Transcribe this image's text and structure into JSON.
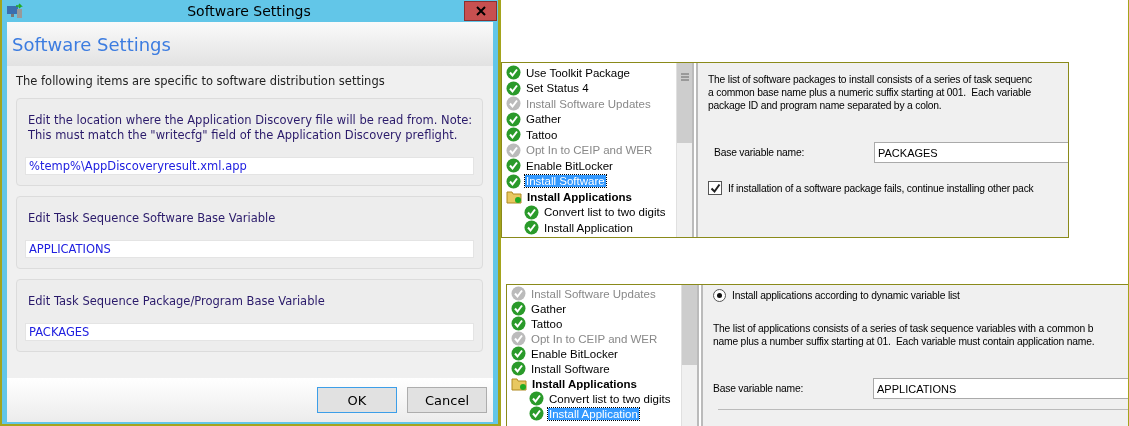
{
  "dialog": {
    "title": "Software Settings",
    "heading": "Software Settings",
    "intro": "The following items are specific to software distribution settings",
    "groups": [
      {
        "label": "Edit the location where the Application Discovery file will be read from. Note: This must match the \"writecfg\" field of the Application Discovery preflight.",
        "value": "%temp%\\AppDiscoveryresult.xml.app"
      },
      {
        "label": "Edit Task Sequence Software Base Variable",
        "value": "APPLICATIONS"
      },
      {
        "label": "Edit Task Sequence Package/Program Base Variable",
        "value": "PACKAGES"
      }
    ],
    "buttons": [
      {
        "label": "OK",
        "default": true
      },
      {
        "label": "Cancel",
        "default": false
      }
    ]
  },
  "panels": [
    {
      "tree": [
        {
          "label": "Use Toolkit Package",
          "kind": "step",
          "enabled": true,
          "selected": false
        },
        {
          "label": "Set Status 4",
          "kind": "step",
          "enabled": true,
          "selected": false
        },
        {
          "label": "Install Software Updates",
          "kind": "step",
          "enabled": false,
          "selected": false
        },
        {
          "label": "Gather",
          "kind": "step",
          "enabled": true,
          "selected": false
        },
        {
          "label": "Tattoo",
          "kind": "step",
          "enabled": true,
          "selected": false
        },
        {
          "label": "Opt In to CEIP and WER",
          "kind": "step",
          "enabled": false,
          "selected": false
        },
        {
          "label": "Enable BitLocker",
          "kind": "step",
          "enabled": true,
          "selected": false
        },
        {
          "label": "Install Software",
          "kind": "step",
          "enabled": true,
          "selected": true
        },
        {
          "label": "Install Applications",
          "kind": "group",
          "enabled": true,
          "selected": false,
          "children": [
            {
              "label": "Convert list to two digits",
              "kind": "step",
              "enabled": true,
              "selected": false
            },
            {
              "label": "Install Application",
              "kind": "step",
              "enabled": true,
              "selected": false
            }
          ]
        }
      ],
      "content": [
        {
          "kind": "text",
          "lines": [
            "The list of software packages to install consists of a series of task sequenc",
            "a common base name plus a numeric suffix starting at 001.  Each variable",
            "package ID and program name separated by a colon."
          ]
        },
        {
          "kind": "field",
          "label": "Base variable name:",
          "value": "PACKAGES"
        },
        {
          "kind": "checkbox",
          "label": "If installation of a software package fails, continue installing other pack",
          "checked": true
        }
      ]
    },
    {
      "tree": [
        {
          "label": "Install Software Updates",
          "kind": "step",
          "enabled": false,
          "selected": false
        },
        {
          "label": "Gather",
          "kind": "step",
          "enabled": true,
          "selected": false
        },
        {
          "label": "Tattoo",
          "kind": "step",
          "enabled": true,
          "selected": false
        },
        {
          "label": "Opt In to CEIP and WER",
          "kind": "step",
          "enabled": false,
          "selected": false
        },
        {
          "label": "Enable BitLocker",
          "kind": "step",
          "enabled": true,
          "selected": false
        },
        {
          "label": "Install Software",
          "kind": "step",
          "enabled": true,
          "selected": false
        },
        {
          "label": "Install Applications",
          "kind": "group",
          "enabled": true,
          "selected": false,
          "children": [
            {
              "label": "Convert list to two digits",
              "kind": "step",
              "enabled": true,
              "selected": false
            },
            {
              "label": "Install Application",
              "kind": "step",
              "enabled": true,
              "selected": true
            }
          ]
        }
      ],
      "content": [
        {
          "kind": "radio",
          "label": "Install applications according to dynamic variable list",
          "checked": true
        },
        {
          "kind": "text",
          "lines": [
            "The list of applications consists of a series of task sequence variables with a common b",
            "name plus a number suffix starting at 01.  Each variable must contain application name."
          ]
        },
        {
          "kind": "field",
          "label": "Base variable name:",
          "value": "APPLICATIONS"
        }
      ]
    }
  ]
}
